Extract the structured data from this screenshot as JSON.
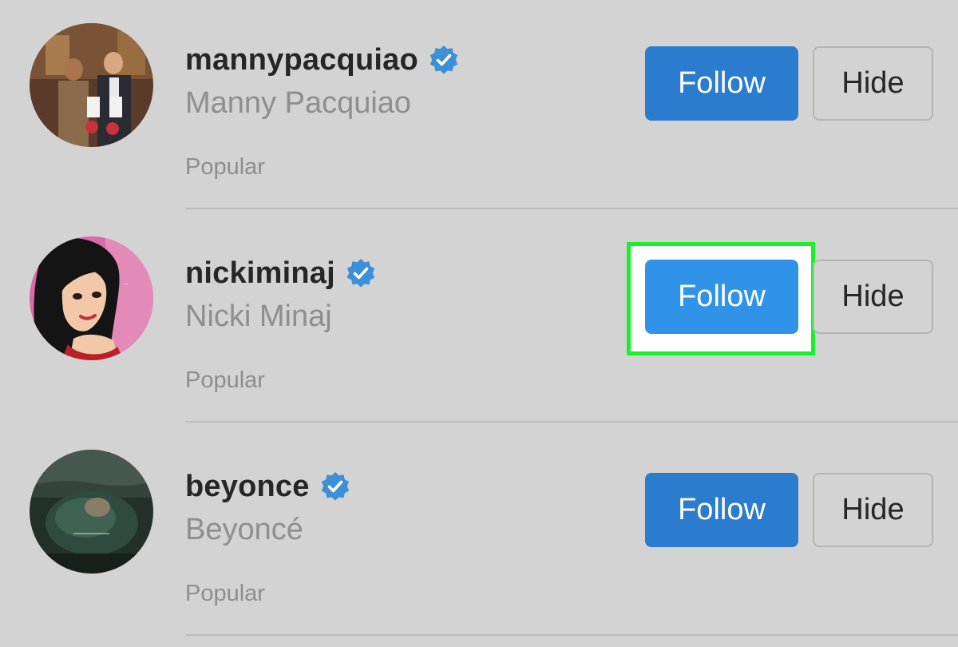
{
  "suggestions": [
    {
      "username": "mannypacquiao",
      "full_name": "Manny Pacquiao",
      "reason": "Popular",
      "verified": true,
      "follow_label": "Follow",
      "hide_label": "Hide",
      "avatar_description": "photo-avatar"
    },
    {
      "username": "nickiminaj",
      "full_name": "Nicki Minaj",
      "reason": "Popular",
      "verified": true,
      "follow_label": "Follow",
      "hide_label": "Hide",
      "avatar_description": "illustrated-avatar",
      "highlighted": true
    },
    {
      "username": "beyonce",
      "full_name": "Beyoncé",
      "reason": "Popular",
      "verified": true,
      "follow_label": "Follow",
      "hide_label": "Hide",
      "avatar_description": "album-cover-avatar"
    }
  ],
  "icons": {
    "verified": "verified-badge-icon"
  },
  "colors": {
    "background": "#d3d3d3",
    "follow_button": "#2b7bce",
    "follow_button_active": "#3193e8",
    "verified_badge": "#3d8fd8",
    "highlight": "#19f02a",
    "primary_text": "#262626",
    "secondary_text": "#8e8e8e"
  }
}
